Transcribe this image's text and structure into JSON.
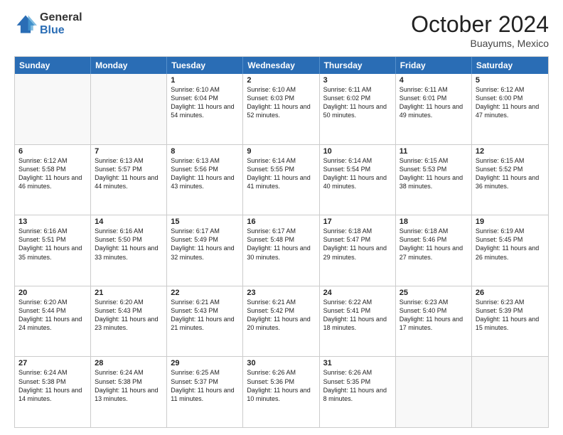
{
  "logo": {
    "general": "General",
    "blue": "Blue"
  },
  "title": "October 2024",
  "location": "Buayums, Mexico",
  "days": [
    "Sunday",
    "Monday",
    "Tuesday",
    "Wednesday",
    "Thursday",
    "Friday",
    "Saturday"
  ],
  "weeks": [
    [
      {
        "day": "",
        "text": ""
      },
      {
        "day": "",
        "text": ""
      },
      {
        "day": "1",
        "text": "Sunrise: 6:10 AM\nSunset: 6:04 PM\nDaylight: 11 hours and 54 minutes."
      },
      {
        "day": "2",
        "text": "Sunrise: 6:10 AM\nSunset: 6:03 PM\nDaylight: 11 hours and 52 minutes."
      },
      {
        "day": "3",
        "text": "Sunrise: 6:11 AM\nSunset: 6:02 PM\nDaylight: 11 hours and 50 minutes."
      },
      {
        "day": "4",
        "text": "Sunrise: 6:11 AM\nSunset: 6:01 PM\nDaylight: 11 hours and 49 minutes."
      },
      {
        "day": "5",
        "text": "Sunrise: 6:12 AM\nSunset: 6:00 PM\nDaylight: 11 hours and 47 minutes."
      }
    ],
    [
      {
        "day": "6",
        "text": "Sunrise: 6:12 AM\nSunset: 5:58 PM\nDaylight: 11 hours and 46 minutes."
      },
      {
        "day": "7",
        "text": "Sunrise: 6:13 AM\nSunset: 5:57 PM\nDaylight: 11 hours and 44 minutes."
      },
      {
        "day": "8",
        "text": "Sunrise: 6:13 AM\nSunset: 5:56 PM\nDaylight: 11 hours and 43 minutes."
      },
      {
        "day": "9",
        "text": "Sunrise: 6:14 AM\nSunset: 5:55 PM\nDaylight: 11 hours and 41 minutes."
      },
      {
        "day": "10",
        "text": "Sunrise: 6:14 AM\nSunset: 5:54 PM\nDaylight: 11 hours and 40 minutes."
      },
      {
        "day": "11",
        "text": "Sunrise: 6:15 AM\nSunset: 5:53 PM\nDaylight: 11 hours and 38 minutes."
      },
      {
        "day": "12",
        "text": "Sunrise: 6:15 AM\nSunset: 5:52 PM\nDaylight: 11 hours and 36 minutes."
      }
    ],
    [
      {
        "day": "13",
        "text": "Sunrise: 6:16 AM\nSunset: 5:51 PM\nDaylight: 11 hours and 35 minutes."
      },
      {
        "day": "14",
        "text": "Sunrise: 6:16 AM\nSunset: 5:50 PM\nDaylight: 11 hours and 33 minutes."
      },
      {
        "day": "15",
        "text": "Sunrise: 6:17 AM\nSunset: 5:49 PM\nDaylight: 11 hours and 32 minutes."
      },
      {
        "day": "16",
        "text": "Sunrise: 6:17 AM\nSunset: 5:48 PM\nDaylight: 11 hours and 30 minutes."
      },
      {
        "day": "17",
        "text": "Sunrise: 6:18 AM\nSunset: 5:47 PM\nDaylight: 11 hours and 29 minutes."
      },
      {
        "day": "18",
        "text": "Sunrise: 6:18 AM\nSunset: 5:46 PM\nDaylight: 11 hours and 27 minutes."
      },
      {
        "day": "19",
        "text": "Sunrise: 6:19 AM\nSunset: 5:45 PM\nDaylight: 11 hours and 26 minutes."
      }
    ],
    [
      {
        "day": "20",
        "text": "Sunrise: 6:20 AM\nSunset: 5:44 PM\nDaylight: 11 hours and 24 minutes."
      },
      {
        "day": "21",
        "text": "Sunrise: 6:20 AM\nSunset: 5:43 PM\nDaylight: 11 hours and 23 minutes."
      },
      {
        "day": "22",
        "text": "Sunrise: 6:21 AM\nSunset: 5:43 PM\nDaylight: 11 hours and 21 minutes."
      },
      {
        "day": "23",
        "text": "Sunrise: 6:21 AM\nSunset: 5:42 PM\nDaylight: 11 hours and 20 minutes."
      },
      {
        "day": "24",
        "text": "Sunrise: 6:22 AM\nSunset: 5:41 PM\nDaylight: 11 hours and 18 minutes."
      },
      {
        "day": "25",
        "text": "Sunrise: 6:23 AM\nSunset: 5:40 PM\nDaylight: 11 hours and 17 minutes."
      },
      {
        "day": "26",
        "text": "Sunrise: 6:23 AM\nSunset: 5:39 PM\nDaylight: 11 hours and 15 minutes."
      }
    ],
    [
      {
        "day": "27",
        "text": "Sunrise: 6:24 AM\nSunset: 5:38 PM\nDaylight: 11 hours and 14 minutes."
      },
      {
        "day": "28",
        "text": "Sunrise: 6:24 AM\nSunset: 5:38 PM\nDaylight: 11 hours and 13 minutes."
      },
      {
        "day": "29",
        "text": "Sunrise: 6:25 AM\nSunset: 5:37 PM\nDaylight: 11 hours and 11 minutes."
      },
      {
        "day": "30",
        "text": "Sunrise: 6:26 AM\nSunset: 5:36 PM\nDaylight: 11 hours and 10 minutes."
      },
      {
        "day": "31",
        "text": "Sunrise: 6:26 AM\nSunset: 5:35 PM\nDaylight: 11 hours and 8 minutes."
      },
      {
        "day": "",
        "text": ""
      },
      {
        "day": "",
        "text": ""
      }
    ]
  ]
}
